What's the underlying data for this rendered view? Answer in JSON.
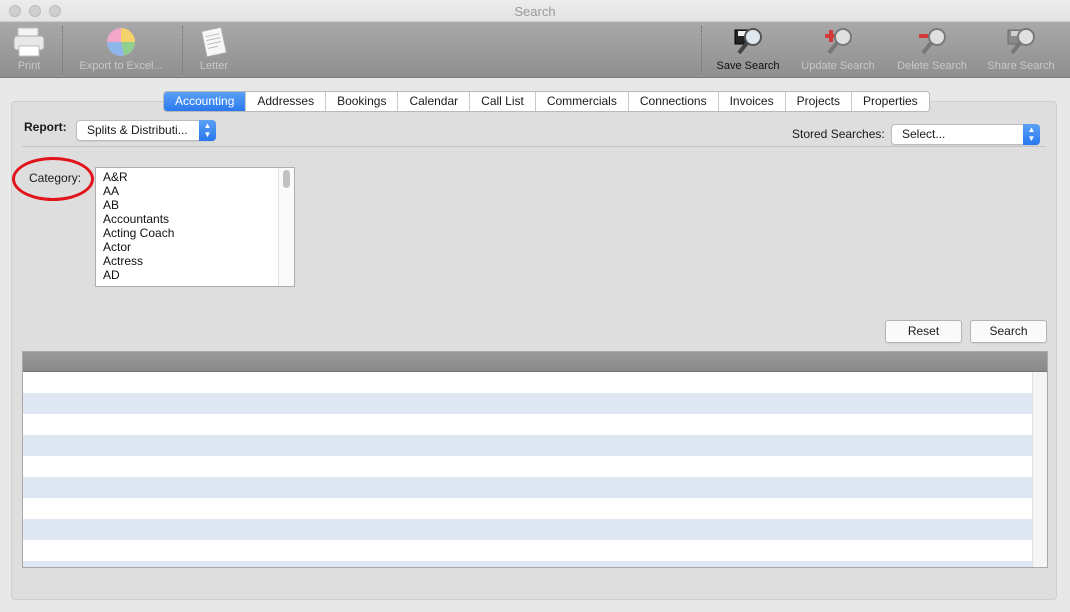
{
  "window": {
    "title": "Search"
  },
  "toolbar": {
    "left_tools": [
      {
        "label": "Print",
        "icon": "printer-icon",
        "enabled": false
      },
      {
        "label": "Export to Excel...",
        "icon": "pie-chart-icon",
        "enabled": false
      },
      {
        "label": "Letter",
        "icon": "letter-icon",
        "enabled": false
      }
    ],
    "right_tools": [
      {
        "label": "Save Search",
        "icon": "save-search-icon",
        "enabled": true
      },
      {
        "label": "Update Search",
        "icon": "update-search-icon",
        "enabled": false
      },
      {
        "label": "Delete Search",
        "icon": "delete-search-icon",
        "enabled": false
      },
      {
        "label": "Share Search",
        "icon": "share-search-icon",
        "enabled": false
      }
    ]
  },
  "tabs": [
    {
      "label": "Accounting",
      "selected": true
    },
    {
      "label": "Addresses"
    },
    {
      "label": "Bookings"
    },
    {
      "label": "Calendar"
    },
    {
      "label": "Call List"
    },
    {
      "label": "Commercials"
    },
    {
      "label": "Connections"
    },
    {
      "label": "Invoices"
    },
    {
      "label": "Projects"
    },
    {
      "label": "Properties"
    }
  ],
  "report": {
    "label": "Report:",
    "value": "Splits & Distributi..."
  },
  "stored_searches": {
    "label": "Stored Searches:",
    "value": "Select..."
  },
  "category": {
    "label": "Category:",
    "items": [
      "A&R",
      "AA",
      "AB",
      "Accountants",
      "Acting Coach",
      "Actor",
      "Actress",
      "AD"
    ]
  },
  "buttons": {
    "reset": "Reset",
    "search": "Search"
  },
  "colors": {
    "accent": "#2a78ef",
    "annotation": "#e0141a",
    "row_alt": "#dfe7f3"
  }
}
